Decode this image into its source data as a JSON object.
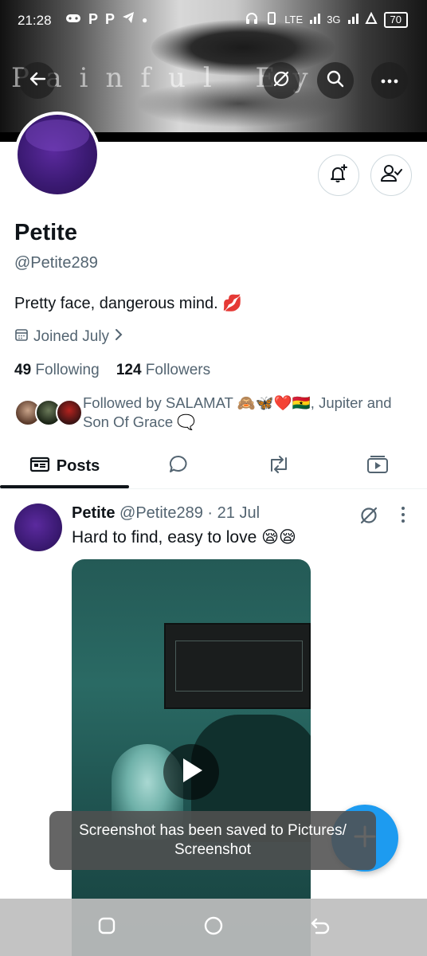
{
  "status_bar": {
    "time": "21:28",
    "left_icons": [
      "gamepad-icon",
      "p-icon",
      "p-icon",
      "telegram-icon",
      "dot-icon"
    ],
    "network_lte": "LTE",
    "network_3g": "3G",
    "battery": "70"
  },
  "banner": {
    "overlay_text": "Painful Ey"
  },
  "profile": {
    "name": "Petite",
    "handle": "@Petite289",
    "bio": "Pretty face, dangerous mind. 💋",
    "joined": "Joined July",
    "following_count": "49",
    "following_label": "Following",
    "followers_count": "124",
    "followers_label": "Followers",
    "followed_by": "Followed by SALAMAT 🙈🦋❤️🇬🇭, Jupiter and Son Of Grace 🗨️"
  },
  "tabs": {
    "posts_label": "Posts",
    "active": "Posts"
  },
  "post": {
    "author": "Petite",
    "handle": "@Petite289",
    "separator": "·",
    "date": "21 Jul",
    "text": "Hard to find, easy to love 😪😪"
  },
  "toast": {
    "message": "Screenshot has been saved to  Pictures/ Screenshot"
  },
  "colors": {
    "accent": "#1d9bf0",
    "secondary_text": "#536471",
    "primary_text": "#0f1419",
    "border": "#cfd9de"
  }
}
